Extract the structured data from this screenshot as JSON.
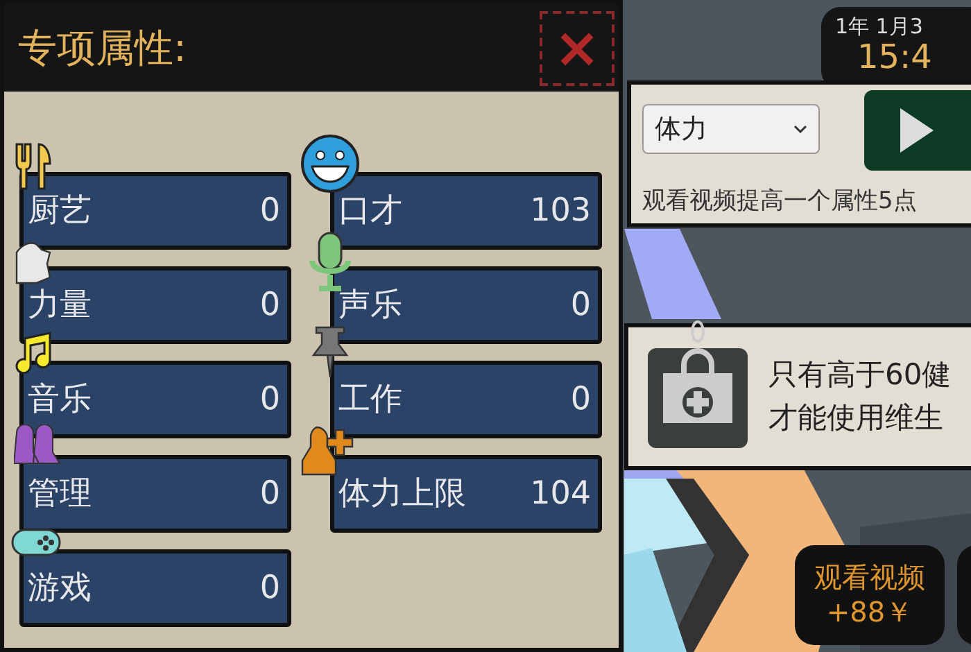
{
  "attributes_panel": {
    "title": "专项属性:",
    "close": "×",
    "columns": [
      [
        {
          "kind": "cutlery",
          "label": "厨艺",
          "value": "0"
        },
        {
          "kind": "muscle",
          "label": "力量",
          "value": "0"
        },
        {
          "kind": "note",
          "label": "音乐",
          "value": "0"
        },
        {
          "kind": "people",
          "label": "管理",
          "value": "0"
        },
        {
          "kind": "gamepad",
          "label": "游戏",
          "value": "0"
        }
      ],
      [
        {
          "kind": "smiley",
          "label": "口才",
          "value": "103"
        },
        {
          "kind": "mic",
          "label": "声乐",
          "value": "0"
        },
        {
          "kind": "pin",
          "label": "工作",
          "value": "0"
        },
        {
          "kind": "person-plus",
          "label": "体力上限",
          "value": "104"
        }
      ]
    ]
  },
  "clock": {
    "date": "1年 1月3",
    "time": "15:4"
  },
  "video_boost": {
    "select_value": "体力",
    "description": "观看视频提高一个属性5点"
  },
  "notice": {
    "lines": [
      "只有高于60健",
      "才能使用维生"
    ]
  },
  "reward_button": {
    "label": "观看视频",
    "amount": "+88￥"
  }
}
